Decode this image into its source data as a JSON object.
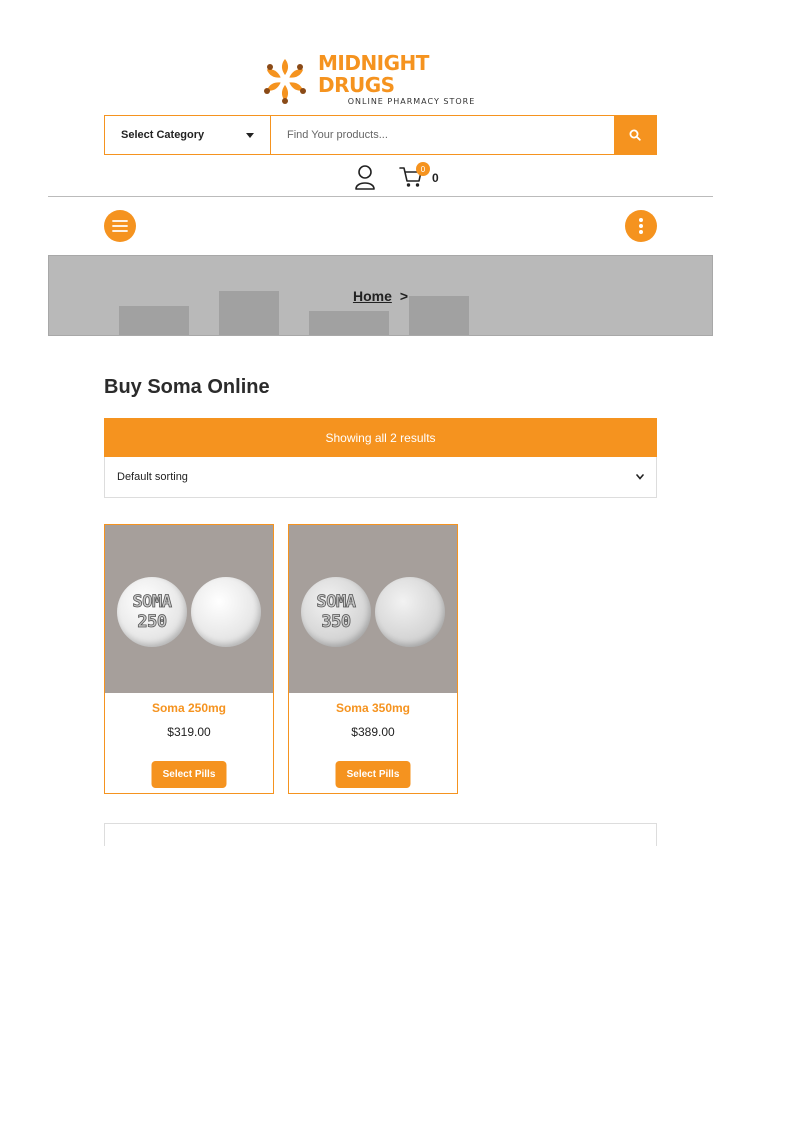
{
  "logo": {
    "title": "MIDNIGHT DRUGS",
    "subtitle": "ONLINE PHARMACY STORE"
  },
  "search": {
    "category_label": "Select Category",
    "placeholder": "Find Your products..."
  },
  "header": {
    "cart_badge": "0",
    "cart_count": "0"
  },
  "breadcrumb": {
    "home": "Home",
    "separator": ">"
  },
  "page": {
    "title": "Buy Soma Online",
    "results_text": "Showing all 2 results",
    "sorting_label": "Default sorting"
  },
  "products": [
    {
      "name": "Soma 250mg",
      "price": "$319.00",
      "button": "Select Pills",
      "pill_line1": "SOMA",
      "pill_line2": "250"
    },
    {
      "name": "Soma 350mg",
      "price": "$389.00",
      "button": "Select Pills",
      "pill_line1": "SOMA",
      "pill_line2": "350"
    }
  ],
  "colors": {
    "accent": "#f5931f",
    "banner": "#b9b9b9",
    "product_bg": "#a69f9b"
  },
  "icons": [
    "logo-mark-icon",
    "search-icon",
    "user-icon",
    "cart-icon",
    "hamburger-icon",
    "more-vertical-icon",
    "chevron-down-icon"
  ]
}
